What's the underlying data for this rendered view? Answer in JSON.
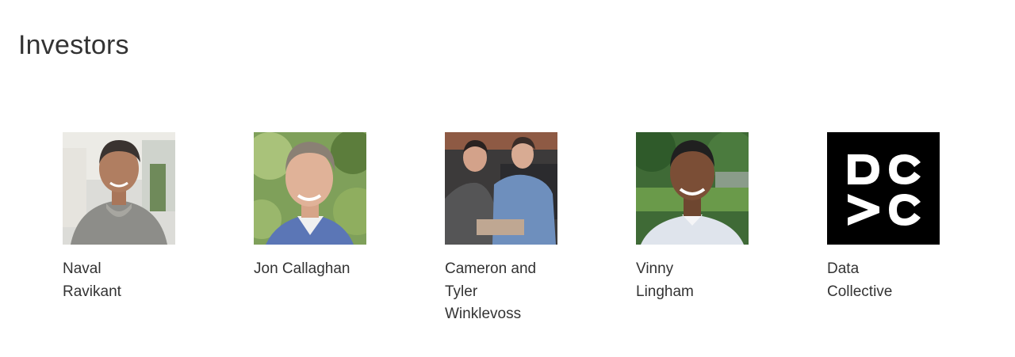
{
  "section": {
    "title": "Investors"
  },
  "investors": [
    {
      "lines": [
        "Naval",
        "Ravikant"
      ],
      "photo": "portrait-naval-ravikant"
    },
    {
      "lines": [
        "Jon Callaghan"
      ],
      "photo": "portrait-jon-callaghan"
    },
    {
      "lines": [
        "Cameron and",
        "Tyler",
        "Winklevoss"
      ],
      "photo": "portrait-winklevoss-twins"
    },
    {
      "lines": [
        "Vinny",
        "Lingham"
      ],
      "photo": "portrait-vinny-lingham"
    },
    {
      "lines": [
        "Data",
        "Collective"
      ],
      "photo": "dcvc-logo"
    }
  ],
  "colors": {
    "text": "#333333",
    "background": "#ffffff",
    "logo_bg": "#000000",
    "logo_fg": "#ffffff"
  }
}
